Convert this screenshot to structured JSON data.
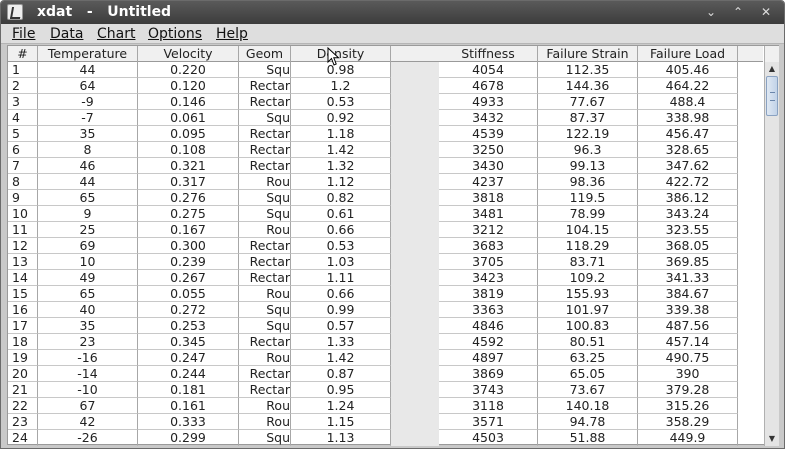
{
  "window": {
    "title": "xdat   -   Untitled",
    "min_glyph": "⌄",
    "max_glyph": "⌃",
    "close_glyph": "✕"
  },
  "menu": [
    {
      "label": "File"
    },
    {
      "label": "Data"
    },
    {
      "label": "Chart"
    },
    {
      "label": "Options"
    },
    {
      "label": "Help"
    }
  ],
  "table": {
    "headers": [
      "#",
      "Temperature",
      "Velocity",
      "Geom",
      "Density",
      "Stiffness",
      "Failure Strain",
      "Failure Load"
    ],
    "rows": [
      [
        "1",
        "44",
        "0.220",
        "Squ",
        "0.98",
        "4054",
        "112.35",
        "405.46"
      ],
      [
        "2",
        "64",
        "0.120",
        "Rectar",
        "1.2",
        "4678",
        "144.36",
        "464.22"
      ],
      [
        "3",
        "-9",
        "0.146",
        "Rectar",
        "0.53",
        "4933",
        "77.67",
        "488.4"
      ],
      [
        "4",
        "-7",
        "0.061",
        "Squ",
        "0.92",
        "3432",
        "87.37",
        "338.98"
      ],
      [
        "5",
        "35",
        "0.095",
        "Rectar",
        "1.18",
        "4539",
        "122.19",
        "456.47"
      ],
      [
        "6",
        "8",
        "0.108",
        "Rectar",
        "1.42",
        "3250",
        "96.3",
        "328.65"
      ],
      [
        "7",
        "46",
        "0.321",
        "Rectar",
        "1.32",
        "3430",
        "99.13",
        "347.62"
      ],
      [
        "8",
        "44",
        "0.317",
        "Rou",
        "1.12",
        "4237",
        "98.36",
        "422.72"
      ],
      [
        "9",
        "65",
        "0.276",
        "Squ",
        "0.82",
        "3818",
        "119.5",
        "386.12"
      ],
      [
        "10",
        "9",
        "0.275",
        "Squ",
        "0.61",
        "3481",
        "78.99",
        "343.24"
      ],
      [
        "11",
        "25",
        "0.167",
        "Rou",
        "0.66",
        "3212",
        "104.15",
        "323.55"
      ],
      [
        "12",
        "69",
        "0.300",
        "Rectar",
        "0.53",
        "3683",
        "118.29",
        "368.05"
      ],
      [
        "13",
        "10",
        "0.239",
        "Rectar",
        "1.03",
        "3705",
        "83.71",
        "369.85"
      ],
      [
        "14",
        "49",
        "0.267",
        "Rectar",
        "1.11",
        "3423",
        "109.2",
        "341.33"
      ],
      [
        "15",
        "65",
        "0.055",
        "Rou",
        "0.66",
        "3819",
        "155.93",
        "384.67"
      ],
      [
        "16",
        "40",
        "0.272",
        "Squ",
        "0.99",
        "3363",
        "101.97",
        "339.38"
      ],
      [
        "17",
        "35",
        "0.253",
        "Squ",
        "0.57",
        "4846",
        "100.83",
        "487.56"
      ],
      [
        "18",
        "23",
        "0.345",
        "Rectar",
        "1.33",
        "4592",
        "80.51",
        "457.14"
      ],
      [
        "19",
        "-16",
        "0.247",
        "Rou",
        "1.42",
        "4897",
        "63.25",
        "490.75"
      ],
      [
        "20",
        "-14",
        "0.244",
        "Rectar",
        "0.87",
        "3869",
        "65.05",
        "390"
      ],
      [
        "21",
        "-10",
        "0.181",
        "Rectar",
        "0.95",
        "3743",
        "73.67",
        "379.28"
      ],
      [
        "22",
        "67",
        "0.161",
        "Rou",
        "1.24",
        "3118",
        "140.18",
        "315.26"
      ],
      [
        "23",
        "42",
        "0.333",
        "Rou",
        "1.15",
        "3571",
        "94.78",
        "358.29"
      ],
      [
        "24",
        "-26",
        "0.299",
        "Squ",
        "1.13",
        "4503",
        "51.88",
        "449.9"
      ]
    ]
  },
  "scrollbar": {
    "up_glyph": "▲",
    "down_glyph": "▼"
  }
}
